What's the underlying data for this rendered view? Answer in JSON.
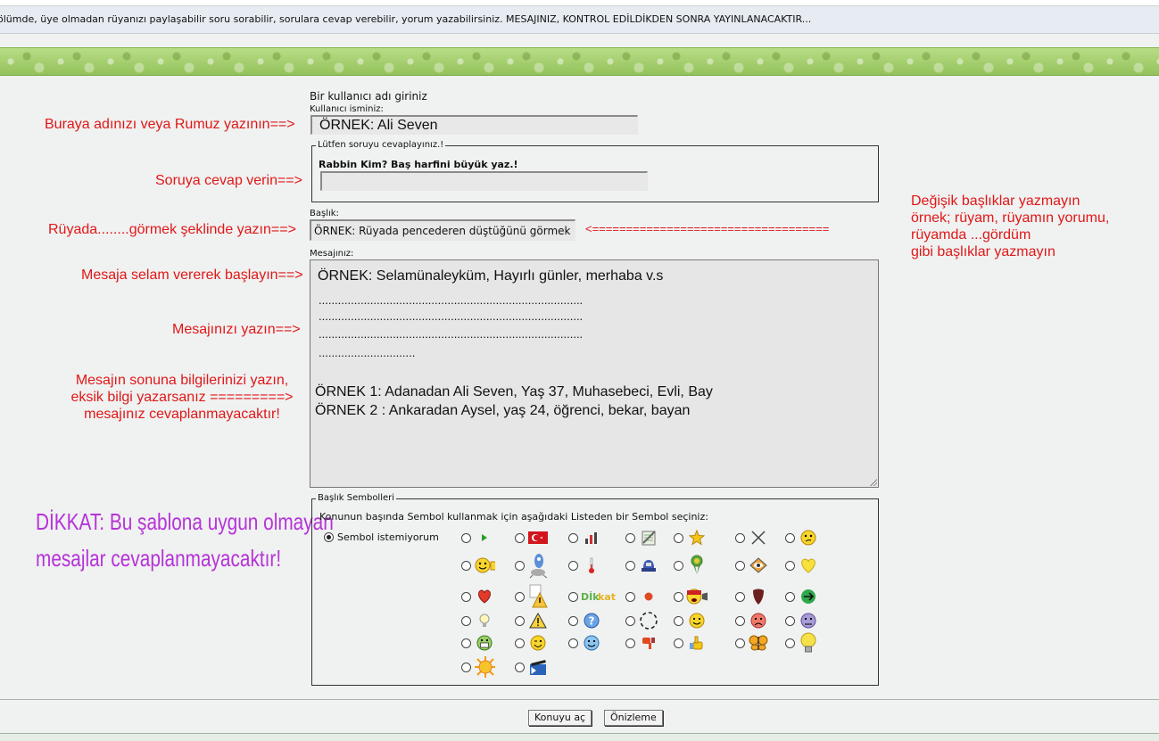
{
  "notice": "ölümde, üye olmadan rüyanızı paylaşabilir soru sorabilir, sorulara cevap verebilir, yorum yazabilirsiniz. MESAJINIZ, KONTROL EDİLDİKDEN SONRA YAYINLANACAKTIR...",
  "form": {
    "username_prompt": "Bir kullanıcı adı giriniz",
    "username_label": "Kullanıcı isminiz:",
    "username_value": "ÖRNEK: Ali Seven",
    "question_legend": "Lütfen soruyu cevaplayınız.!",
    "question_text": "Rabbin Kim? Baş harfini büyük yaz.!",
    "answer_value": "",
    "subject_label": "Başlık:",
    "subject_value": "ÖRNEK: Rüyada pencederen düştüğünü görmek",
    "message_label": "Mesajınız:",
    "message_lines": [
      "ÖRNEK: Selamünaleyküm, Hayırlı günler, merhaba v.s",
      "..................................................................................",
      "..................................................................................",
      "..................................................................................",
      "..............................",
      "ÖRNEK 1: Adanadan Ali Seven, Yaş 37, Muhasebeci, Evli, Bay",
      "ÖRNEK 2 : Ankaradan Aysel, yaş 24, öğrenci, bekar, bayan"
    ],
    "symbols_legend": "Başlık Sembolleri",
    "symbols_prompt": "Konunun başında Sembol kullanmak için aşağıdaki Listeden bir Sembol seçiniz:",
    "no_symbol_label": "Sembol istemiyorum",
    "dikkat_label": "Dİkkat"
  },
  "annotations": {
    "name_hint": "Buraya adınızı veya Rumuz yazının==>",
    "answer_hint": "Soruya cevap verin==>",
    "subject_hint": "Rüyada........görmek şeklinde yazın==>",
    "greeting_hint": "Mesaja selam vererek başlayın==>",
    "message_hint": "Mesajınızı yazın==>",
    "info_hint": [
      "Mesajın sonuna bilgilerinizi yazın,",
      "eksik bilgi yazarsanız =========>",
      "mesajınız cevaplanmayacaktır!"
    ],
    "arrow": "<===================================",
    "titles_hint": [
      "Değişik başlıklar yazmayın",
      "örnek; rüyam, rüyamın yorumu,",
      "rüyamda ...gördüm",
      "gibi başlıklar yazmayın"
    ],
    "dikkat": [
      "DİKKAT: Bu şablona uygun olmayan",
      "mesajlar cevaplanmayacaktır!"
    ]
  },
  "symbol_icons": [
    "arrow-icon",
    "turkish-flag-icon",
    "chart-icon",
    "notepad-icon",
    "star-icon",
    "cross-icon",
    "thinking-icon",
    "smiley-icon",
    "rocket-icon",
    "thermometer-icon",
    "police-icon",
    "ribbon-icon",
    "eye-icon",
    "heart-yellow-icon",
    "heart-red-icon",
    "alert-icon",
    "dikkat-icon",
    "dot-icon",
    "flag-shouting-icon",
    "shield-icon",
    "arrow-circle-icon",
    "bulb-icon",
    "warning-icon",
    "question-icon",
    "dashed-circle-icon",
    "smile-icon",
    "sad-icon",
    "grumpy-icon",
    "grin-icon",
    "wink-icon",
    "happy-icon",
    "thumbs-down-icon",
    "thumbs-up-icon",
    "butterfly-icon",
    "lightbulb-icon",
    "sun-icon",
    "clapper-icon"
  ],
  "buttons": {
    "submit": "Konuyu aç",
    "preview": "Önizleme"
  }
}
